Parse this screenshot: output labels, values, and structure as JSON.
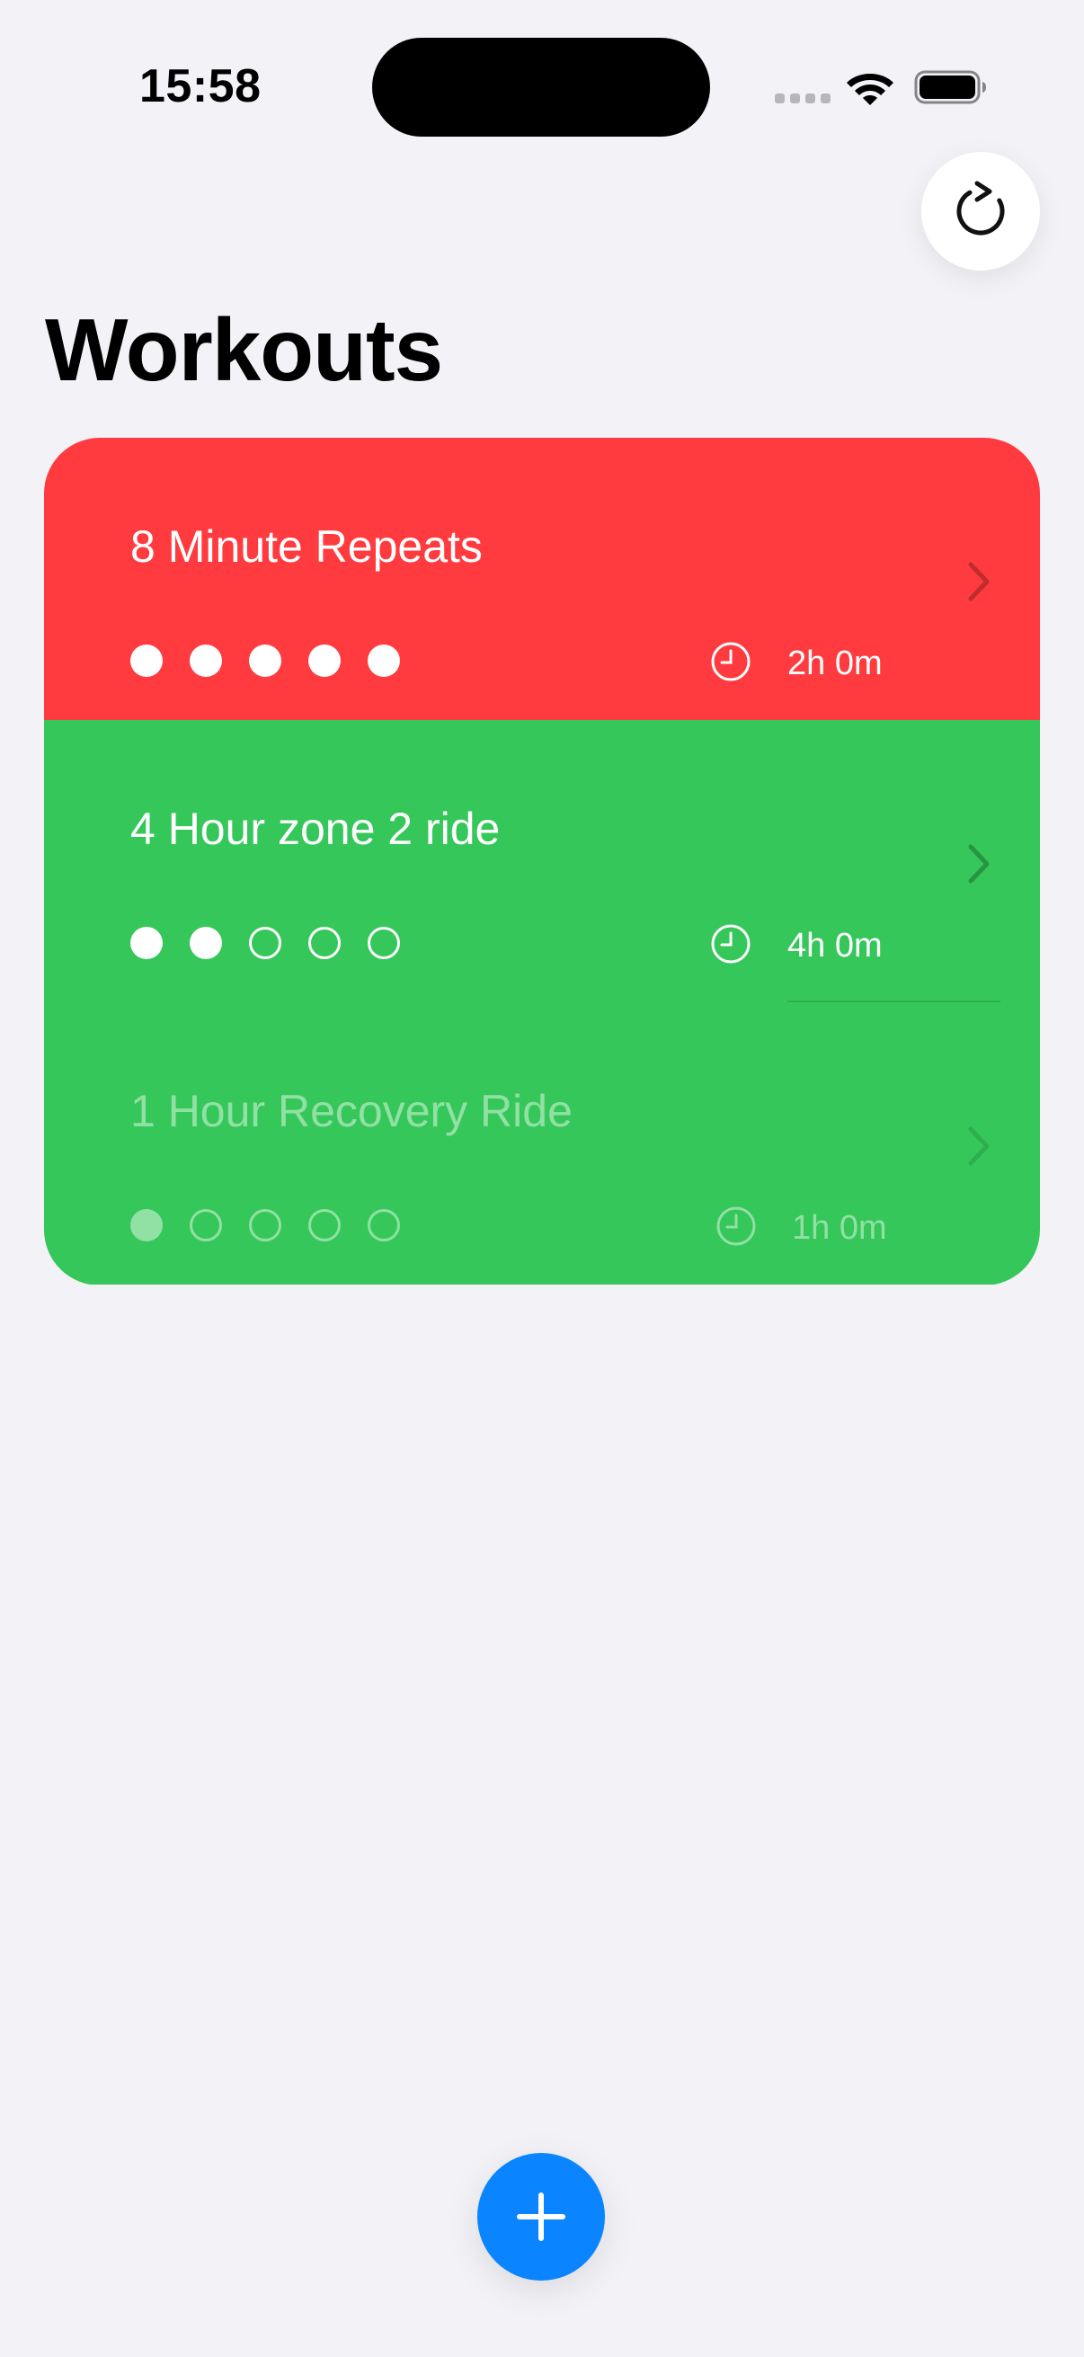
{
  "status_bar": {
    "time": "15:58"
  },
  "header": {
    "title": "Workouts",
    "refresh_icon": "arrow-clockwise-icon"
  },
  "workouts": [
    {
      "name": "8 Minute Repeats",
      "intensity": 5,
      "intensity_max": 5,
      "duration": "2h 0m",
      "color": "#ff3b3f",
      "dimmed": false
    },
    {
      "name": "4 Hour zone 2 ride",
      "intensity": 2,
      "intensity_max": 5,
      "duration": "4h 0m",
      "color": "#36c75a",
      "dimmed": false
    },
    {
      "name": "1 Hour Recovery Ride",
      "intensity": 1,
      "intensity_max": 5,
      "duration": "1h 0m",
      "color": "#36c75a",
      "dimmed": true
    }
  ],
  "fab": {
    "icon": "plus-icon",
    "color": "#0a84ff"
  }
}
